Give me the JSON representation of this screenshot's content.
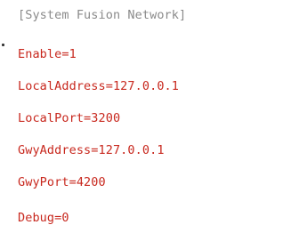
{
  "file": {
    "lines": [
      {
        "kind": "section",
        "text": "[System Fusion Network]"
      },
      {
        "kind": "entry",
        "text": "Enable=1"
      },
      {
        "kind": "entry",
        "text": "LocalAddress=127.0.0.1"
      },
      {
        "kind": "entry",
        "text": "LocalPort=3200"
      },
      {
        "kind": "entry",
        "text": "GwyAddress=127.0.0.1"
      },
      {
        "kind": "entry",
        "text": "GwyPort=4200"
      },
      {
        "kind": "entry",
        "text": "Debug=0"
      }
    ]
  },
  "colors": {
    "section_text": "#8a8a8a",
    "entry_text": "#c8281e",
    "background": "#ffffff"
  }
}
